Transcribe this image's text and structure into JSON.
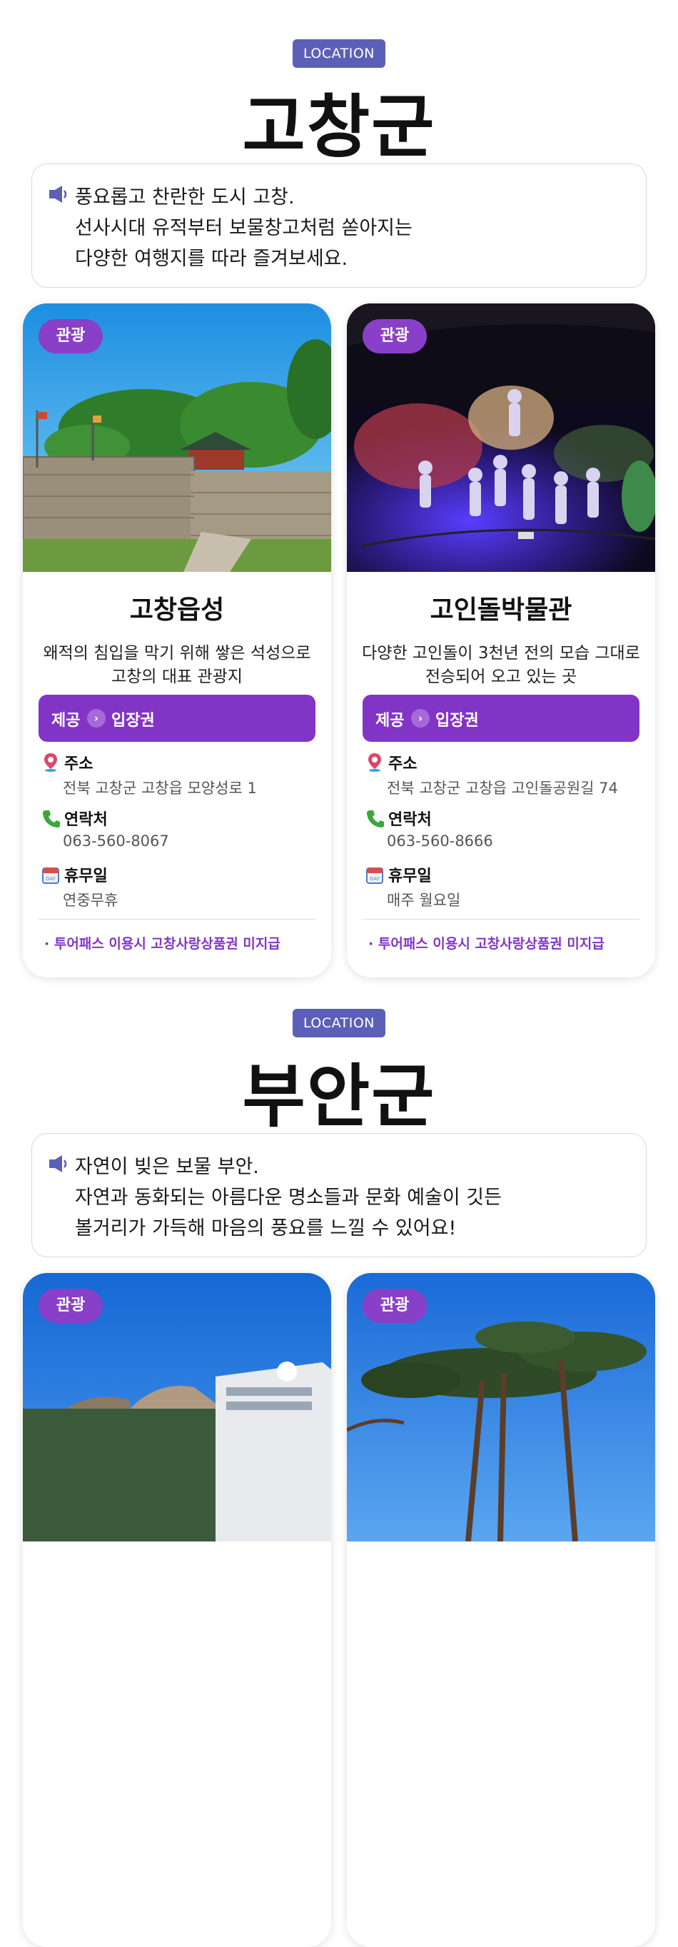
{
  "sections": [
    {
      "badge": "LOCATION",
      "title": "고창군",
      "intro": [
        "풍요롭고 찬란한 도시 고창.",
        "선사시대 유적부터 보물창고처럼 쏟아지는",
        "다양한 여행지를 따라 즐겨보세요."
      ],
      "cards": [
        {
          "tag": "관광",
          "name": "고창읍성",
          "desc": [
            "왜적의 침입을 막기 위해 쌓은 석성으로",
            "고창의 대표 관광지"
          ],
          "provide_label": "제공",
          "provide_value": "입장권",
          "address_label": "주소",
          "address": "전북 고창군 고창읍 모양성로 1",
          "contact_label": "연락처",
          "contact": "063-560-8067",
          "holiday_label": "휴무일",
          "holiday": "연중무휴",
          "note": "· 투어패스 이용시 고창사랑상품권 미지급"
        },
        {
          "tag": "관광",
          "name": "고인돌박물관",
          "desc": [
            "다양한 고인돌이 3천년 전의 모습 그대로",
            "전승되어 오고 있는 곳"
          ],
          "provide_label": "제공",
          "provide_value": "입장권",
          "address_label": "주소",
          "address": "전북 고창군 고창읍 고인돌공원길 74",
          "contact_label": "연락처",
          "contact": "063-560-8666",
          "holiday_label": "휴무일",
          "holiday": "매주 월요일",
          "note": "· 투어패스 이용시 고창사랑상품권 미지급"
        }
      ]
    },
    {
      "badge": "LOCATION",
      "title": "부안군",
      "intro": [
        "자연이 빚은 보물 부안.",
        "자연과 동화되는 아름다운 명소들과 문화 예술이 깃든",
        "볼거리가 가득해 마음의 풍요를 느낄 수 있어요!"
      ],
      "cards": [
        {
          "tag": "관광"
        },
        {
          "tag": "관광"
        }
      ]
    }
  ],
  "colors": {
    "badge": "#5b5fb8",
    "accent_purple": "#8234c7",
    "tag_purple": "#8a3fc9"
  },
  "icons": [
    "speaker-icon",
    "location-pin-icon",
    "phone-icon",
    "calendar-icon",
    "chevron-right-icon"
  ]
}
